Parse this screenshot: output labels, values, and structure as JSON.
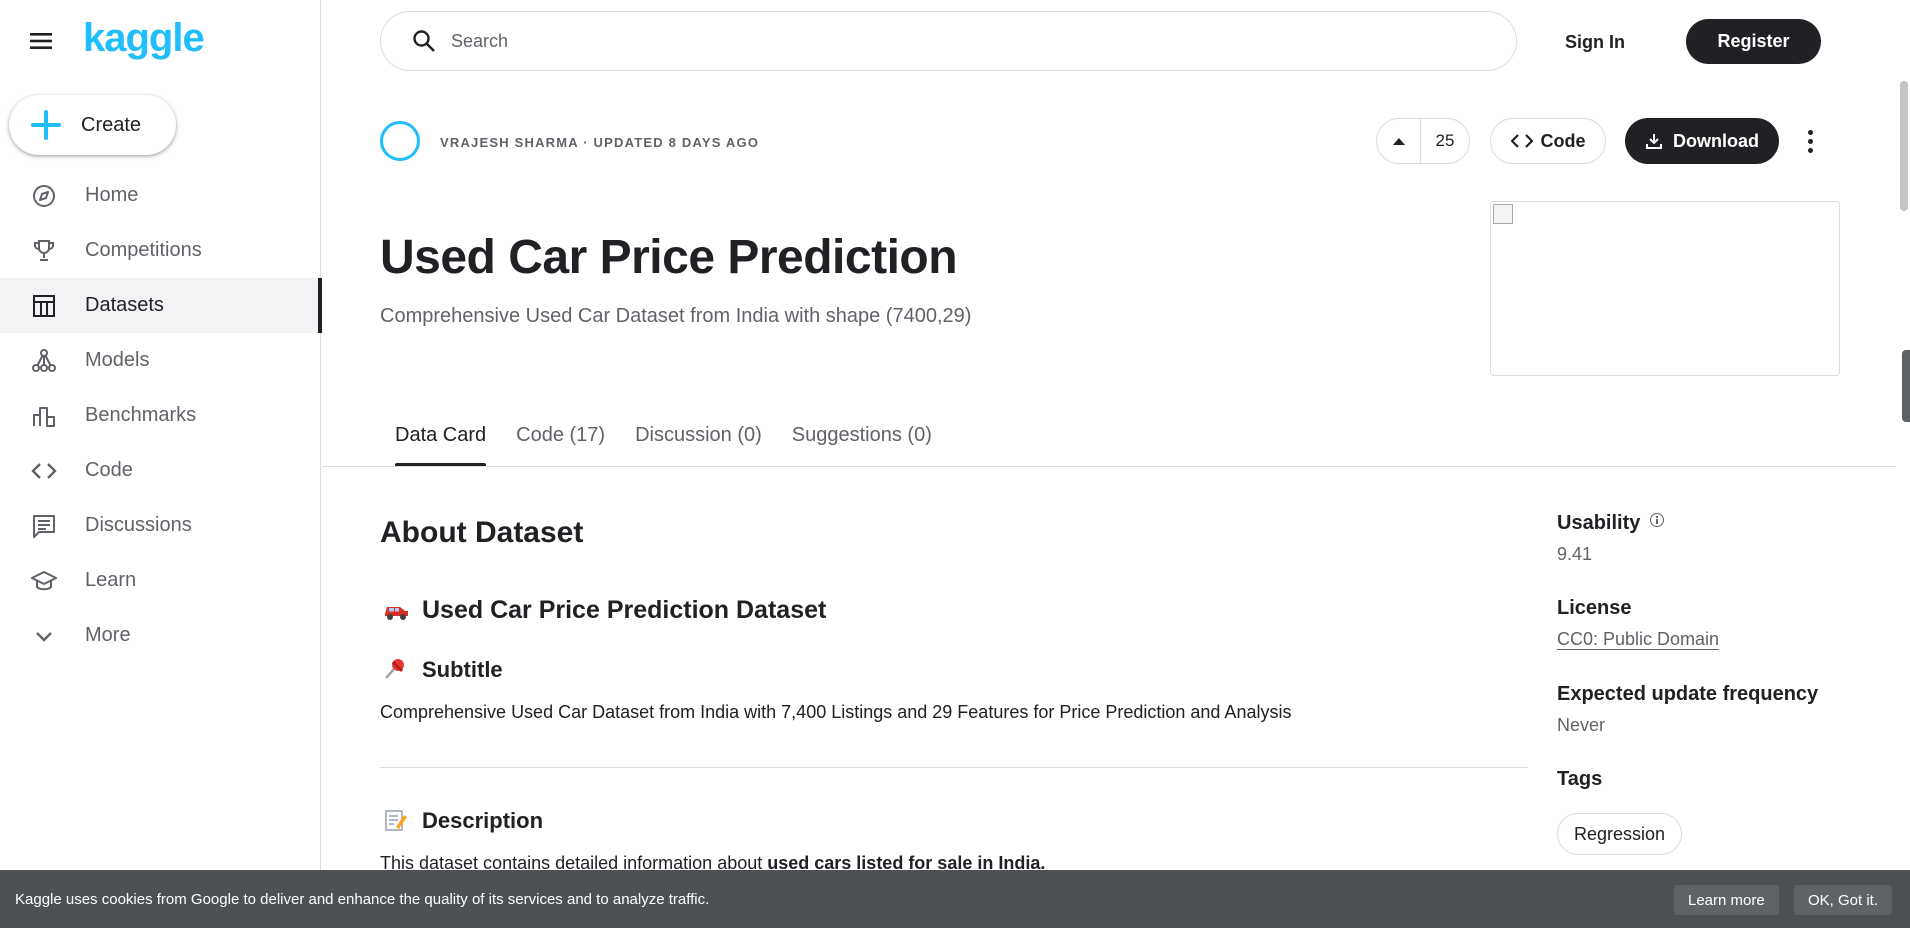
{
  "brand": {
    "logo": "kaggle",
    "accent": "#20beff"
  },
  "sidebar": {
    "create_label": "Create",
    "items": [
      {
        "label": "Home",
        "icon": "compass-icon"
      },
      {
        "label": "Competitions",
        "icon": "trophy-icon"
      },
      {
        "label": "Datasets",
        "icon": "table-icon",
        "active": true
      },
      {
        "label": "Models",
        "icon": "models-icon"
      },
      {
        "label": "Benchmarks",
        "icon": "bar-chart-icon"
      },
      {
        "label": "Code",
        "icon": "code-icon"
      },
      {
        "label": "Discussions",
        "icon": "comment-icon"
      },
      {
        "label": "Learn",
        "icon": "school-icon"
      },
      {
        "label": "More",
        "icon": "chevron-down-icon"
      }
    ]
  },
  "topbar": {
    "search_placeholder": "Search",
    "sign_in": "Sign In",
    "register": "Register"
  },
  "dataset": {
    "owner_line": "VRAJESH SHARMA · UPDATED 8 DAYS AGO",
    "votes": "25",
    "code_label": "Code",
    "download_label": "Download",
    "title": "Used Car Price Prediction",
    "subtitle": "Comprehensive Used Car Dataset from India with shape (7400,29)"
  },
  "tabs": [
    {
      "label": "Data Card",
      "active": true
    },
    {
      "label": "Code (17)"
    },
    {
      "label": "Discussion (0)"
    },
    {
      "label": "Suggestions (0)"
    }
  ],
  "content": {
    "about_heading": "About Dataset",
    "h_dataset": "Used Car Price Prediction Dataset",
    "h_subtitle": "Subtitle",
    "subtitle_text": "Comprehensive Used Car Dataset from India with 7,400 Listings and 29 Features for Price Prediction and Analysis",
    "h_description": "Description",
    "desc_prefix": "This dataset contains detailed information about ",
    "desc_bold": "used cars listed for sale in India."
  },
  "meta": {
    "usability_label": "Usability",
    "usability_value": "9.41",
    "license_label": "License",
    "license_value": "CC0: Public Domain",
    "frequency_label": "Expected update frequency",
    "frequency_value": "Never",
    "tags_label": "Tags",
    "tags": [
      "Regression"
    ]
  },
  "cookie": {
    "text": "Kaggle uses cookies from Google to deliver and enhance the quality of its services and to analyze traffic.",
    "learn_more": "Learn more",
    "ok": "OK, Got it."
  }
}
